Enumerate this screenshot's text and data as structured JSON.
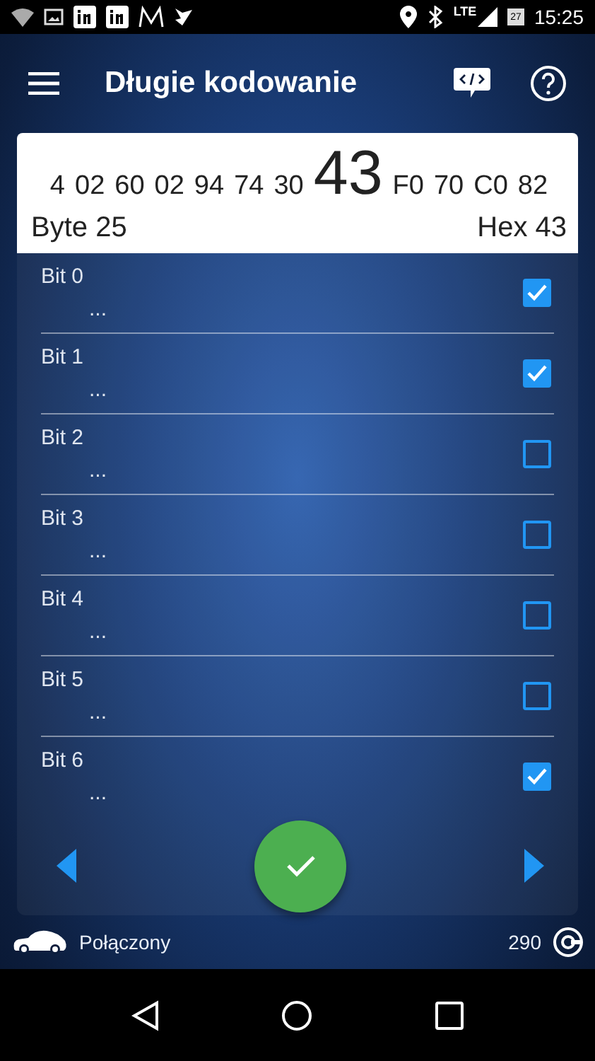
{
  "status_bar": {
    "network": "LTE",
    "calendar_day": "27",
    "time": "15:25"
  },
  "app_bar": {
    "title": "Długie kodowanie"
  },
  "byte_card": {
    "bytes": [
      {
        "text": "4",
        "selected": false
      },
      {
        "text": "02",
        "selected": false
      },
      {
        "text": "60",
        "selected": false
      },
      {
        "text": "02",
        "selected": false
      },
      {
        "text": "94",
        "selected": false
      },
      {
        "text": "74",
        "selected": false
      },
      {
        "text": "30",
        "selected": false
      },
      {
        "text": "43",
        "selected": true
      },
      {
        "text": "F0",
        "selected": false
      },
      {
        "text": "70",
        "selected": false
      },
      {
        "text": "C0",
        "selected": false
      },
      {
        "text": "82",
        "selected": false
      }
    ],
    "byte_label": "Byte 25",
    "hex_label": "Hex 43"
  },
  "bits": [
    {
      "label": "Bit 0",
      "description": "...",
      "checked": true
    },
    {
      "label": "Bit 1",
      "description": "...",
      "checked": true
    },
    {
      "label": "Bit 2",
      "description": "...",
      "checked": false
    },
    {
      "label": "Bit 3",
      "description": "...",
      "checked": false
    },
    {
      "label": "Bit 4",
      "description": "...",
      "checked": false
    },
    {
      "label": "Bit 5",
      "description": "...",
      "checked": false
    },
    {
      "label": "Bit 6",
      "description": "...",
      "checked": true
    }
  ],
  "footer": {
    "connection": "Połączony",
    "counter": "290"
  }
}
